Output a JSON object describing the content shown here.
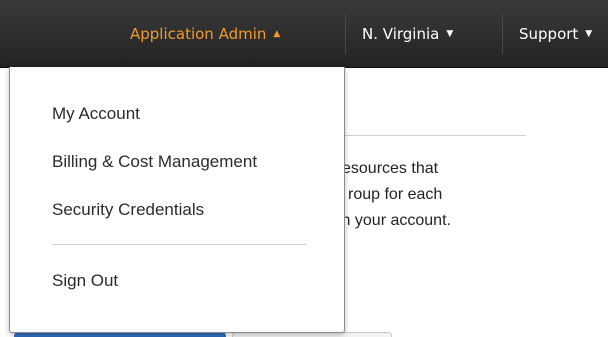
{
  "navbar": {
    "account_label": "Application Admin",
    "region_label": "N. Virginia",
    "support_label": "Support",
    "accent_color": "#f29a2e"
  },
  "dropdown": {
    "items": [
      {
        "label": "My Account"
      },
      {
        "label": "Billing & Cost Management"
      },
      {
        "label": "Security Credentials"
      }
    ],
    "signout_label": "Sign Out"
  },
  "background": {
    "text_lines": [
      "esources that",
      "roup for each",
      "in your account."
    ]
  },
  "icons": {
    "account_caret": "caret-up-icon",
    "region_caret": "caret-down-icon",
    "support_caret": "caret-down-icon"
  }
}
